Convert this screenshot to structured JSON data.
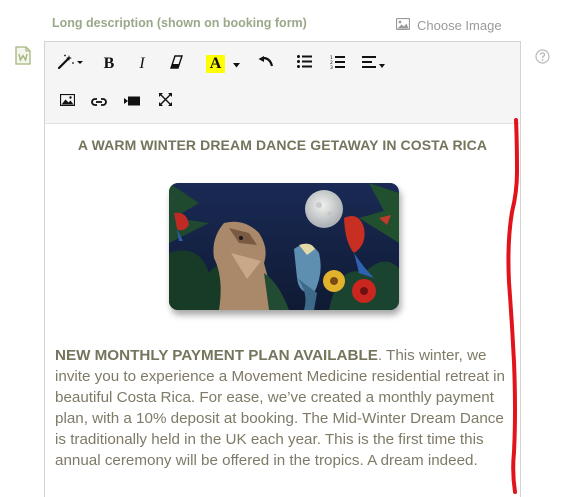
{
  "field": {
    "label": "Long description (shown on booking form)",
    "choose_image_label": "Choose Image"
  },
  "toolbar": {
    "bold_label": "B",
    "italic_label": "I",
    "font_color_label": "A",
    "font_color_highlight": "#ffff00"
  },
  "content": {
    "heading": "A WARM WINTER DREAM DANCE GETAWAY IN COSTA RICA",
    "paragraph_lead": "NEW MONTHLY PAYMENT PLAN AVAILABLE",
    "paragraph_body": ". This winter, we invite you to experience a Movement Medicine residential retreat in beautiful Costa Rica. For ease, we’ve created a monthly payment plan, with a 10% deposit at booking. The Mid-Winter Dream Dance is traditionally held in the UK each year. This is the first time this annual ceremony will be offered in the tropics. A dream indeed."
  },
  "colors": {
    "label_green": "#9aa88a",
    "heading_olive": "#75745c",
    "body_text": "#7e7a66",
    "annotation_red": "#e0141a"
  }
}
